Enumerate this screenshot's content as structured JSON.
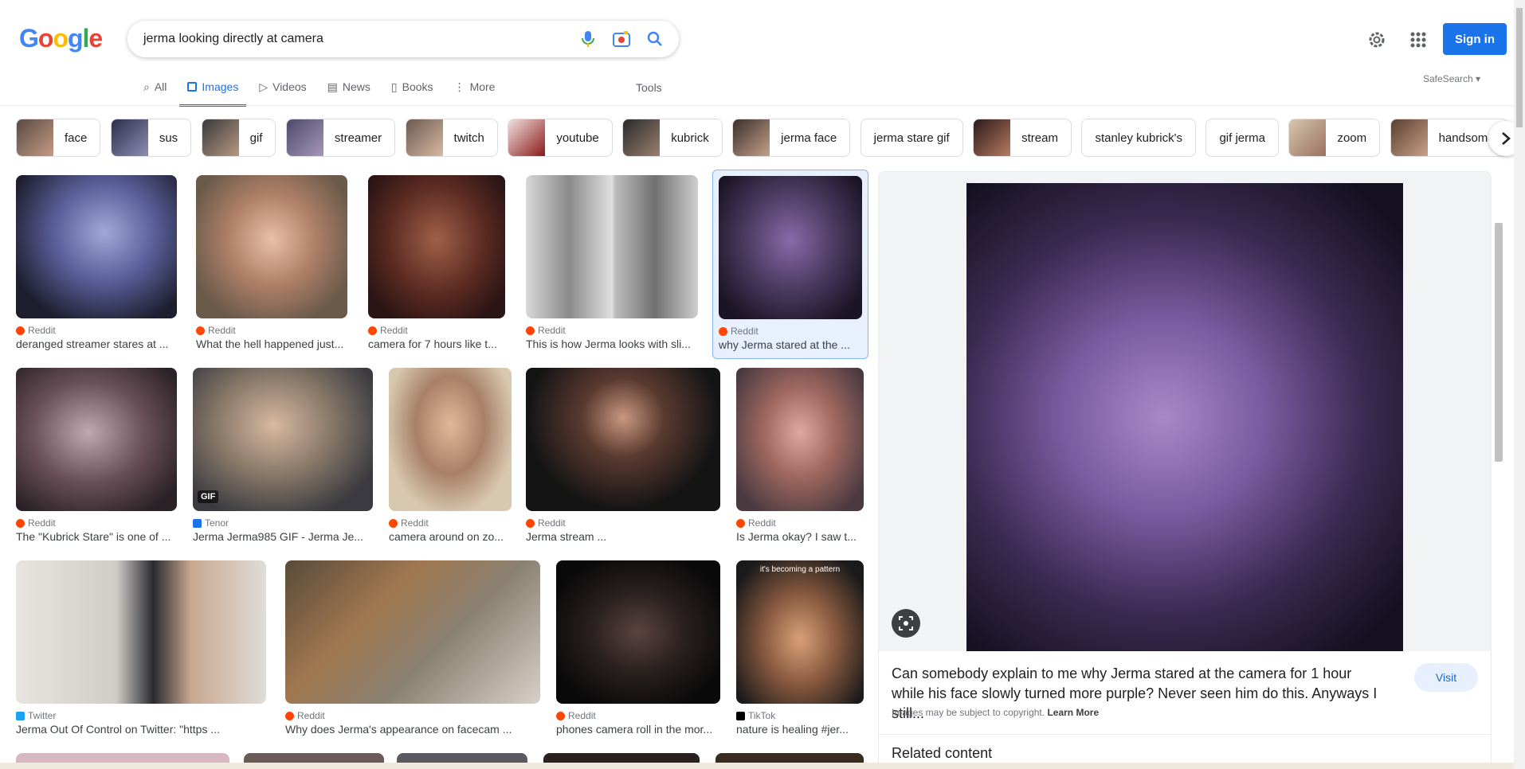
{
  "search": {
    "query": "jerma looking directly at camera"
  },
  "header": {
    "signin_label": "Sign in",
    "safesearch_label": "SafeSearch ▾"
  },
  "tabs": [
    {
      "label": "All"
    },
    {
      "label": "Images"
    },
    {
      "label": "Videos"
    },
    {
      "label": "News"
    },
    {
      "label": "Books"
    },
    {
      "label": "More"
    }
  ],
  "tools_label": "Tools",
  "chips": [
    {
      "label": "face"
    },
    {
      "label": "sus"
    },
    {
      "label": "gif"
    },
    {
      "label": "streamer"
    },
    {
      "label": "twitch"
    },
    {
      "label": "youtube"
    },
    {
      "label": "kubrick"
    },
    {
      "label": "jerma face"
    },
    {
      "label": "jerma stare gif"
    },
    {
      "label": "stream"
    },
    {
      "label": "stanley kubrick's"
    },
    {
      "label": "gif jerma"
    },
    {
      "label": "zoom"
    },
    {
      "label": "handsome"
    }
  ],
  "results": [
    {
      "source": "Reddit",
      "title": "deranged streamer stares at ..."
    },
    {
      "source": "Reddit",
      "title": "What the hell happened just..."
    },
    {
      "source": "Reddit",
      "title": "camera for 7 hours like t..."
    },
    {
      "source": "Reddit",
      "title": "This is how Jerma looks with sli..."
    },
    {
      "source": "Reddit",
      "title": "why Jerma stared at the ..."
    },
    {
      "source": "Reddit",
      "title": "The \"Kubrick Stare\" is one of ..."
    },
    {
      "source": "Tenor",
      "title": "Jerma Jerma985 GIF - Jerma Je..."
    },
    {
      "source": "Reddit",
      "title": "camera around on zo..."
    },
    {
      "source": "Reddit",
      "title": "Jerma stream ..."
    },
    {
      "source": "Reddit",
      "title": "Is Jerma okay? I saw t..."
    },
    {
      "source": "Twitter",
      "title": "Jerma Out Of Control on Twitter: \"https ..."
    },
    {
      "source": "Reddit",
      "title": "Why does Jerma's appearance on facecam ..."
    },
    {
      "source": "Reddit",
      "title": "phones camera roll in the mor..."
    },
    {
      "source": "TikTok",
      "title": "nature is healing #jer..."
    }
  ],
  "gif_badge": "GIF",
  "pattern_caption": "it's becoming a pattern",
  "panel": {
    "caption": "Can somebody explain to me why Jerma stared at the camera for 1 hour while his face slowly turned more purple? Never seen him do this. Anyways I still...",
    "visit_label": "Visit",
    "copyright": "Images may be subject to copyright.",
    "learn_more": "Learn More",
    "related": "Related content"
  },
  "colors": {
    "accent": "#1a73e8",
    "reddit": "#ff4500"
  }
}
